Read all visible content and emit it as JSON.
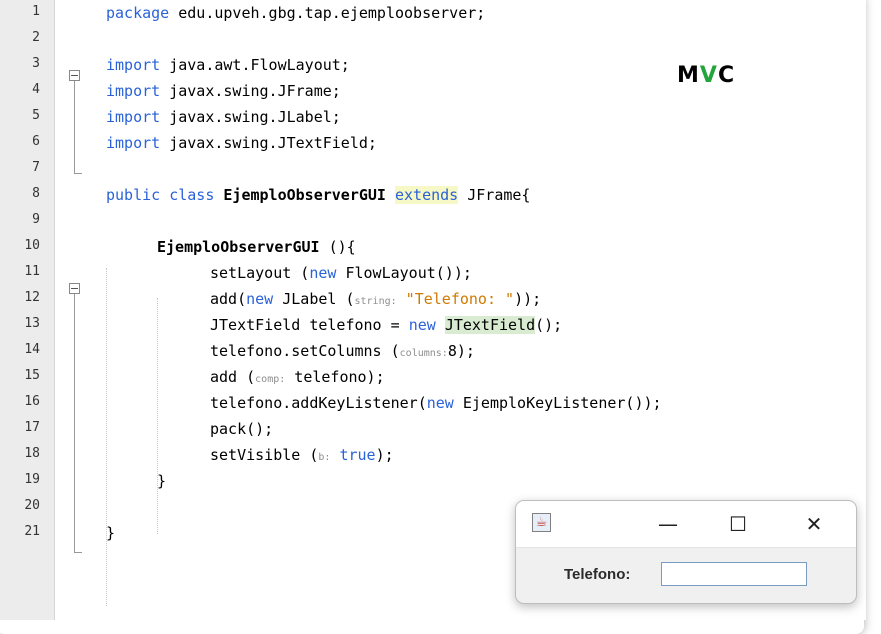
{
  "editor": {
    "line_numbers": [
      "1",
      "2",
      "3",
      "4",
      "5",
      "6",
      "7",
      "8",
      "9",
      "10",
      "11",
      "12",
      "13",
      "14",
      "15",
      "16",
      "17",
      "18",
      "19",
      "20",
      "21"
    ],
    "package": {
      "kw": "package",
      "name": " edu.upveh.gbg.tap.ejemploobserver;"
    },
    "imports": [
      {
        "kw": "import",
        "name": " java.awt.FlowLayout;"
      },
      {
        "kw": "import",
        "name": " javax.swing.JFrame;"
      },
      {
        "kw": "import",
        "name": " javax.swing.JLabel;"
      },
      {
        "kw": "import",
        "name": " javax.swing.JTextField;"
      }
    ],
    "class_decl": {
      "kw": "public class ",
      "name": "EjemploObserverGUI",
      "ext": "extends",
      "rest": " JFrame{"
    },
    "ctor": {
      "name": "EjemploObserverGUI",
      "rest": " (){"
    },
    "body": {
      "l11": {
        "a": "setLayout (",
        "kw": "new",
        "b": " FlowLayout());"
      },
      "l12": {
        "a": "add(",
        "kw": "new",
        "b": " JLabel (",
        "hint": "string:",
        "str": " \"Telefono: \"",
        "c": "));"
      },
      "l13": {
        "a": "JTextField telefono = ",
        "kw": "new",
        "sp": " ",
        "hl": "JTextField",
        "b": "();"
      },
      "l14": {
        "a": "telefono.setColumns (",
        "hint": "columns:",
        "b": "8);"
      },
      "l15": {
        "a": "add (",
        "hint": "comp:",
        "b": " telefono);"
      },
      "l16": {
        "a": "telefono.addKeyListener(",
        "kw": "new",
        "b": " EjemploKeyListener());"
      },
      "l17": {
        "a": "pack();"
      },
      "l18": {
        "a": "setVisible (",
        "hint": "b:",
        "kw": " true",
        "b": ");"
      },
      "l19": {
        "a": "}"
      },
      "l21": {
        "a": "}"
      }
    }
  },
  "overlay_label": {
    "m": "M",
    "v": "V",
    "c": "C"
  },
  "window": {
    "icon": "java-icon",
    "minimize": "—",
    "maximize": "☐",
    "close": "✕",
    "label": "Telefono:",
    "field_value": ""
  }
}
